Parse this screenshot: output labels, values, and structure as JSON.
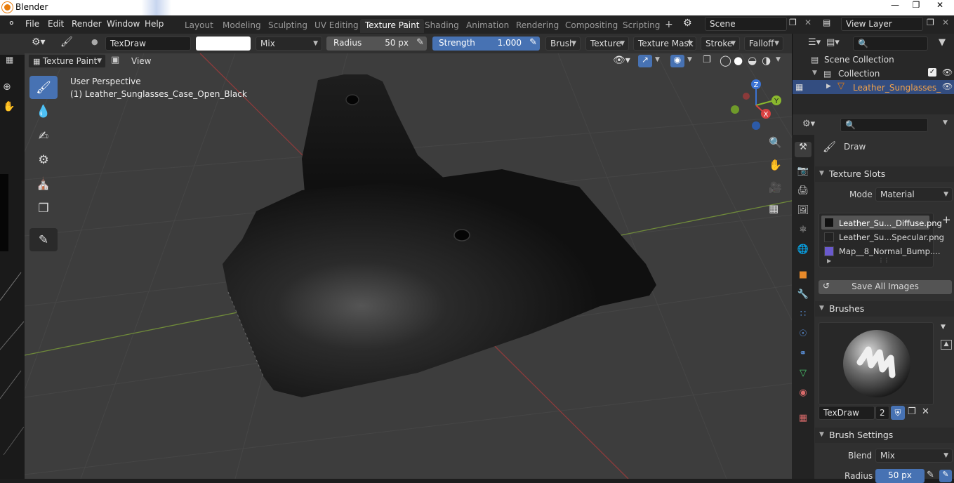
{
  "window": {
    "title": "Blender"
  },
  "menus": [
    "File",
    "Edit",
    "Render",
    "Window",
    "Help"
  ],
  "workspaces": [
    "Layout",
    "Modeling",
    "Sculpting",
    "UV Editing",
    "Texture Paint",
    "Shading",
    "Animation",
    "Rendering",
    "Compositing",
    "Scripting"
  ],
  "workspace_add": "+",
  "scene": {
    "name": "Scene",
    "view_layer": "View Layer"
  },
  "toolheader": {
    "brush_name": "TexDraw",
    "blend": "Mix",
    "radius_label": "Radius",
    "radius_value": "50 px",
    "strength_label": "Strength",
    "strength_value": "1.000",
    "menus": [
      "Brush",
      "Texture",
      "Texture Mask",
      "Stroke",
      "Falloff"
    ]
  },
  "viewport": {
    "mode": "Texture Paint",
    "view_menu": "View",
    "perspective": "User Perspective",
    "object_label": "(1) Leather_Sunglasses_Case_Open_Black",
    "gizmo": {
      "x": "X",
      "y": "Y",
      "z": "Z"
    }
  },
  "outliner": {
    "scene_collection": "Scene Collection",
    "collection": "Collection",
    "object": "Leather_Sunglasses_"
  },
  "properties": {
    "tool_name": "Draw",
    "texture_slots": {
      "header": "Texture Slots",
      "mode_label": "Mode",
      "mode_value": "Material",
      "slots": [
        "Leather_Su..._Diffuse.png",
        "Leather_Su...Specular.png",
        "Map__8_Normal_Bump...."
      ],
      "add": "+",
      "save_all": "Save All Images"
    },
    "brushes": {
      "header": "Brushes",
      "brush_name": "TexDraw",
      "users": "2"
    },
    "brush_settings": {
      "header": "Brush Settings",
      "blend_label": "Blend",
      "blend_value": "Mix",
      "radius_label": "Radius",
      "radius_value": "50 px"
    }
  },
  "colors": {
    "accent": "#4772b3",
    "header_bg": "#303030",
    "viewport_bg": "#3d3d3d",
    "selected_object": "#e87d0d"
  }
}
